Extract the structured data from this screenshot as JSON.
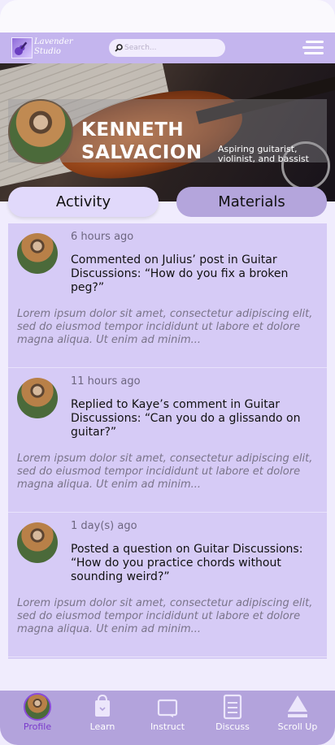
{
  "header": {
    "logo_text": "Lavender Studio",
    "search_placeholder": "Search..."
  },
  "profile": {
    "name": "KENNETH SALVACION",
    "tagline": "Aspiring guitarist, violinist, and bassist"
  },
  "tabs": [
    {
      "label": "Activity",
      "selected": true
    },
    {
      "label": "Materials",
      "selected": false
    }
  ],
  "posts": [
    {
      "time": "6 hours ago",
      "summary": "Commented on Julius’ post in Guitar Discussions: “How do you fix a broken peg?”",
      "excerpt": "Lorem ipsum dolor sit amet, consectetur adipiscing elit, sed do eiusmod tempor incididunt ut labore et dolore magna aliqua. Ut enim ad minim..."
    },
    {
      "time": "11 hours ago",
      "summary": "Replied to Kaye’s comment in Guitar Discussions: “Can you do a glissando on guitar?”",
      "excerpt": "Lorem ipsum dolor sit amet, consectetur adipiscing elit, sed do eiusmod tempor incididunt ut labore et dolore magna aliqua. Ut enim ad minim..."
    },
    {
      "time": "1 day(s) ago",
      "summary": "Posted a question on Guitar Discussions: “How do you practice chords without sounding weird?”",
      "excerpt": "Lorem ipsum dolor sit amet, consectetur adipiscing elit, sed do eiusmod tempor incididunt ut labore et dolore magna aliqua. Ut enim ad minim..."
    }
  ],
  "nav": [
    {
      "label": "Profile",
      "icon": "profile-avatar-icon",
      "active": true
    },
    {
      "label": "Learn",
      "icon": "shopping-bag-icon"
    },
    {
      "label": "Instruct",
      "icon": "chat-box-icon"
    },
    {
      "label": "Discuss",
      "icon": "document-icon"
    },
    {
      "label": "Scroll Up",
      "icon": "eject-up-icon"
    }
  ],
  "colors": {
    "accent": "#c4b5ee",
    "nav_bg": "#b3a3dc",
    "feed_bg": "#d6cbf6",
    "active_nav": "#7a3bcb"
  }
}
